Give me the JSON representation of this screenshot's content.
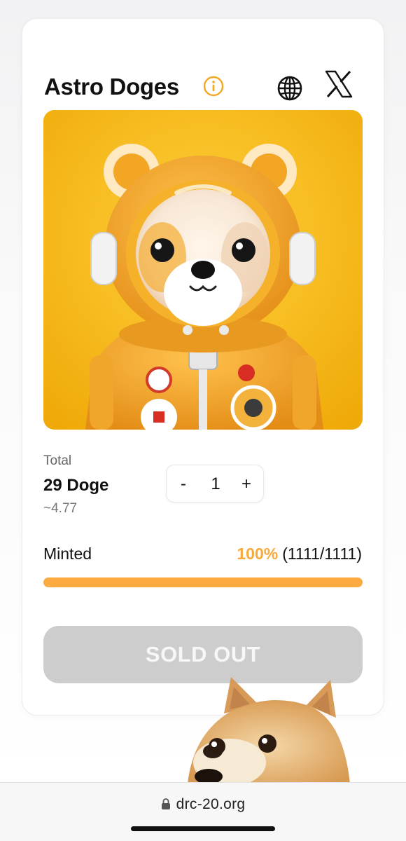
{
  "collection": {
    "title": "Astro Doges",
    "icons": {
      "info": "info-icon",
      "website": "globe-icon",
      "twitter": "x-icon"
    },
    "image_alt": "astronaut-doge-art"
  },
  "mint": {
    "total_label": "Total",
    "total_value": "29 Doge",
    "total_approx": "~4.77",
    "quantity": "1",
    "minus_label": "-",
    "plus_label": "+",
    "minted_label": "Minted",
    "minted_percent": "100%",
    "minted_count": "(1111/1111)",
    "progress": 1.0,
    "button_label": "SOLD OUT"
  },
  "browser": {
    "url": "drc-20.org",
    "lock_icon": "lock-icon"
  },
  "colors": {
    "accent": "#FBAB40",
    "info_accent": "#F5A623",
    "disabled_button": "#CDCDCD",
    "art_background": "#F6B70D"
  }
}
